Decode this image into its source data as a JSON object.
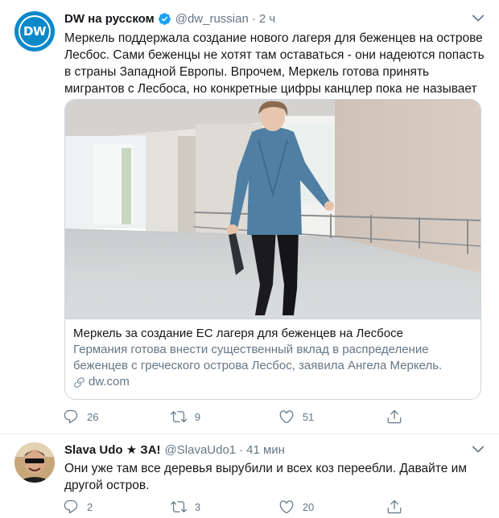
{
  "tweet": {
    "author_name": "DW на русском",
    "handle": "@dw_russian",
    "separator": "·",
    "time": "2 ч",
    "text": "Меркель поддержала создание нового лагеря для беженцев на острове Лесбос. Сами беженцы не хотят там оставаться - они надеются попасть в страны Западной Европы. Впрочем, Меркель готова принять мигрантов с Лесбоса, но конкретные цифры канцлер пока не называет",
    "avatar_text": "DW",
    "card": {
      "title": "Меркель за создание ЕС лагеря для беженцев на Лесбосе",
      "description": "Германия готова внести существенный вклад в распределение беженцев с греческого острова Лесбос, заявила Ангела Меркель.",
      "domain": "dw.com"
    },
    "actions": {
      "replies": "26",
      "retweets": "9",
      "likes": "51"
    }
  },
  "reply": {
    "author_name": "Slava Udo ★ ЗА!",
    "handle": "@SlavaUdo1",
    "separator": "·",
    "time": "41 мин",
    "text": "Они уже там все деревья вырубили и всех коз переебли. Давайте им другой остров.",
    "actions": {
      "replies": "2",
      "retweets": "3",
      "likes": "20"
    }
  },
  "colors": {
    "accent": "#1da1f2",
    "secondary_text": "#657786",
    "dw_blue": "#0a89c9"
  },
  "icons": [
    "verified-icon",
    "chevron-down-icon",
    "reply-icon",
    "retweet-icon",
    "like-icon",
    "share-icon",
    "link-icon"
  ]
}
